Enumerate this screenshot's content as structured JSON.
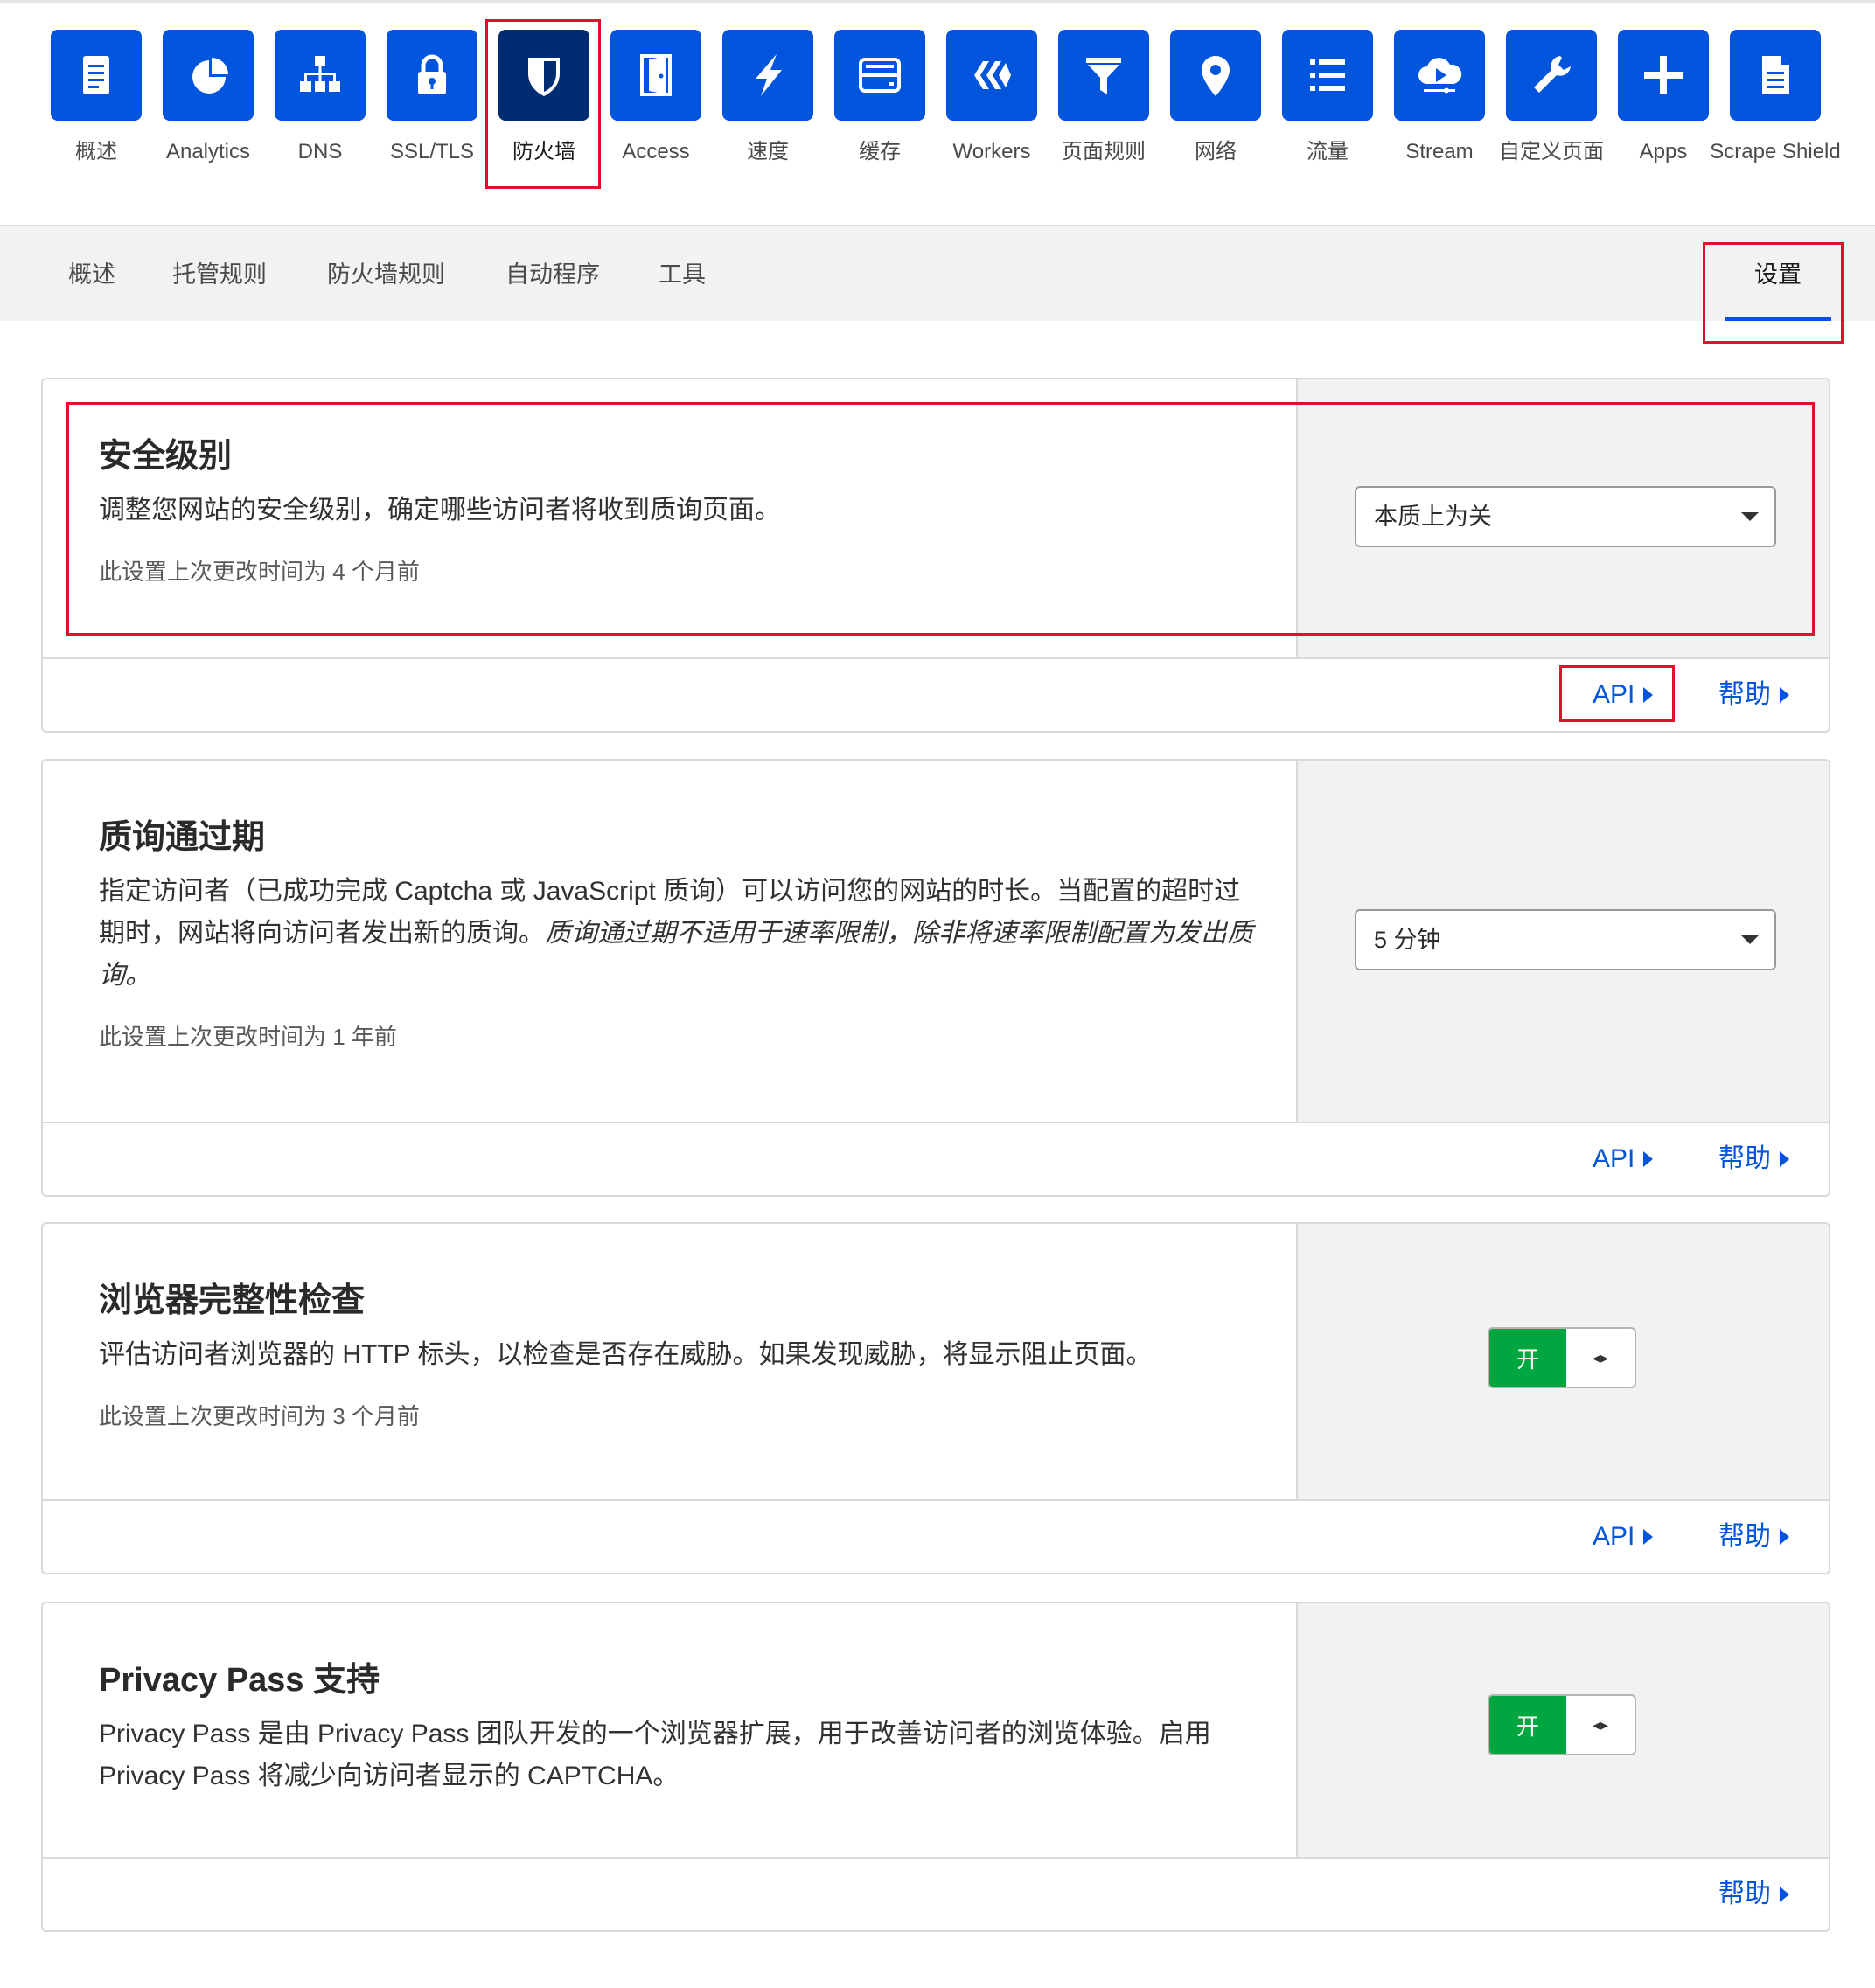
{
  "apps": [
    {
      "label": "概述",
      "icon": "document-icon",
      "active": false
    },
    {
      "label": "Analytics",
      "icon": "pie-chart-icon",
      "active": false
    },
    {
      "label": "DNS",
      "icon": "network-tree-icon",
      "active": false
    },
    {
      "label": "SSL/TLS",
      "icon": "lock-icon",
      "active": false
    },
    {
      "label": "防火墙",
      "icon": "shield-icon",
      "active": true
    },
    {
      "label": "Access",
      "icon": "door-icon",
      "active": false
    },
    {
      "label": "速度",
      "icon": "lightning-icon",
      "active": false
    },
    {
      "label": "缓存",
      "icon": "server-icon",
      "active": false
    },
    {
      "label": "Workers",
      "icon": "workers-icon",
      "active": false
    },
    {
      "label": "页面规则",
      "icon": "filter-icon",
      "active": false
    },
    {
      "label": "网络",
      "icon": "location-pin-icon",
      "active": false
    },
    {
      "label": "流量",
      "icon": "list-icon",
      "active": false
    },
    {
      "label": "Stream",
      "icon": "cloud-play-icon",
      "active": false
    },
    {
      "label": "自定义页面",
      "icon": "wrench-icon",
      "active": false
    },
    {
      "label": "Apps",
      "icon": "plus-icon",
      "active": false
    },
    {
      "label": "Scrape Shield",
      "icon": "page-icon",
      "active": false
    }
  ],
  "subnav": {
    "items": [
      "概述",
      "托管规则",
      "防火墙规则",
      "自动程序",
      "工具"
    ],
    "active_label": "设置"
  },
  "cards": {
    "security_level": {
      "title": "安全级别",
      "desc": "调整您网站的安全级别，确定哪些访问者将收到质询页面。",
      "meta": "此设置上次更改时间为 4 个月前",
      "select_value": "本质上为关",
      "api": "API",
      "help": "帮助"
    },
    "challenge_passage": {
      "title": "质询通过期",
      "desc_plain": "指定访问者（已成功完成 Captcha 或 JavaScript 质询）可以访问您的网站的时长。当配置的超时过期时，网站将向访问者发出新的质询。",
      "desc_italic": "质询通过期不适用于速率限制，除非将速率限制配置为发出质询。",
      "meta": "此设置上次更改时间为 1 年前",
      "select_value": "5 分钟",
      "api": "API",
      "help": "帮助"
    },
    "browser_integrity": {
      "title": "浏览器完整性检查",
      "desc": "评估访问者浏览器的 HTTP 标头，以检查是否存在威胁。如果发现威胁，将显示阻止页面。",
      "meta": "此设置上次更改时间为 3 个月前",
      "toggle_label": "开",
      "toggle_arrows": "◂▸",
      "api": "API",
      "help": "帮助"
    },
    "privacy_pass": {
      "title": "Privacy Pass 支持",
      "desc": "Privacy Pass 是由 Privacy Pass 团队开发的一个浏览器扩展，用于改善访问者的浏览体验。启用 Privacy Pass 将减少向访问者显示的 CAPTCHA。",
      "toggle_label": "开",
      "toggle_arrows": "◂▸",
      "help": "帮助"
    }
  },
  "colors": {
    "brand_blue": "#0055dc",
    "active_dark": "#002d72",
    "toggle_green": "#00a63f",
    "annotation_red": "#e3102d"
  }
}
